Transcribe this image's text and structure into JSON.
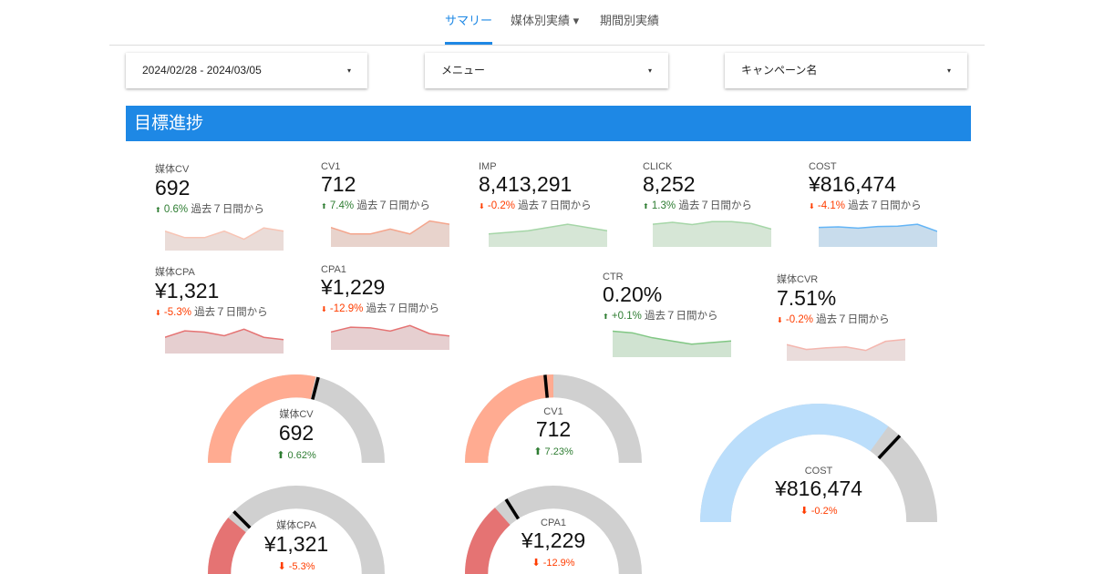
{
  "tabs": [
    {
      "label": "サマリー",
      "active": true
    },
    {
      "label": "媒体別実績 ▾"
    },
    {
      "label": "期間別実績"
    }
  ],
  "filters": {
    "date": "2024/02/28 - 2024/03/05",
    "menu": "メニュー",
    "campaign": "キャンペーン名",
    "caret": "▾"
  },
  "section_title": "目標進捗",
  "period_text": "過去７日間から",
  "kpis": [
    {
      "label": "媒体CV",
      "value": "692",
      "change": "0.6%",
      "dir": "up",
      "color": "#f8c4b4",
      "fill": "#eadcd8",
      "spark": [
        6,
        4,
        4,
        6,
        3.5,
        7,
        6
      ]
    },
    {
      "label": "CV1",
      "value": "712",
      "change": "7.4%",
      "dir": "up",
      "color": "#f4a58c",
      "fill": "#e8d3cc",
      "spark": [
        6,
        4,
        4,
        5.5,
        4,
        8,
        7
      ]
    },
    {
      "label": "IMP",
      "value": "8,413,291",
      "change": "-0.2%",
      "dir": "down",
      "color": "#a5d6a7",
      "fill": "#d6e6d6",
      "spark": [
        4,
        5,
        7,
        5
      ]
    },
    {
      "label": "CLICK",
      "value": "8,252",
      "change": "1.3%",
      "dir": "up",
      "color": "#a5d6a7",
      "fill": "#d6e6d6",
      "spark": [
        7,
        7.6,
        6.9,
        7.8,
        7.8,
        7.2,
        5.5
      ]
    },
    {
      "label": "COST",
      "value": "¥816,474",
      "change": "-4.1%",
      "dir": "down",
      "color": "#64b5f6",
      "fill": "#c8dcec",
      "spark": [
        6,
        6.2,
        5.8,
        6.3,
        6.4,
        7,
        4.8
      ]
    },
    {
      "label": "媒体CPA",
      "value": "¥1,321",
      "change": "-5.3%",
      "dir": "down",
      "color": "#e57373",
      "fill": "#e6cfd0",
      "spark": [
        5,
        7,
        6.6,
        5.5,
        7.5,
        5,
        4.3
      ]
    },
    {
      "label": "CPA1",
      "value": "¥1,229",
      "change": "-12.9%",
      "dir": "down",
      "color": "#e57373",
      "fill": "#e6cfd0",
      "spark": [
        5.5,
        7,
        6.8,
        5.8,
        7.5,
        5,
        4.3
      ]
    },
    {
      "label": "CTR",
      "value": "0.20%",
      "change": "+0.1%",
      "dir": "up",
      "color": "#81c784",
      "fill": "#d0e3d1",
      "spark": [
        8,
        7.5,
        6,
        5,
        4,
        4.5,
        5
      ]
    },
    {
      "label": "媒体CVR",
      "value": "7.51%",
      "change": "-0.2%",
      "dir": "down",
      "color": "#f4b6ae",
      "fill": "#eadcdb",
      "spark": [
        5,
        3.5,
        4,
        4.3,
        3.2,
        6,
        6.6
      ]
    }
  ],
  "gauges": [
    {
      "label": "媒体CV",
      "value": "692",
      "change": "0.62%",
      "dir": "up",
      "color": "#ffab91",
      "progress": 0.57,
      "target": 0.58
    },
    {
      "label": "CV1",
      "value": "712",
      "change": "7.23%",
      "dir": "up",
      "color": "#ffab91",
      "progress": 0.5,
      "target": 0.47
    },
    {
      "label": "媒体CPA",
      "value": "¥1,321",
      "change": "-5.3%",
      "dir": "down",
      "color": "#e57373",
      "progress": 0.22,
      "target": 0.25
    },
    {
      "label": "CPA1",
      "value": "¥1,229",
      "change": "-12.9%",
      "dir": "down",
      "color": "#e57373",
      "progress": 0.27,
      "target": 0.32
    },
    {
      "label": "COST",
      "value": "¥816,474",
      "change": "-0.2%",
      "dir": "down",
      "color": "#bbdefb",
      "progress": 0.7,
      "target": 0.74
    }
  ]
}
